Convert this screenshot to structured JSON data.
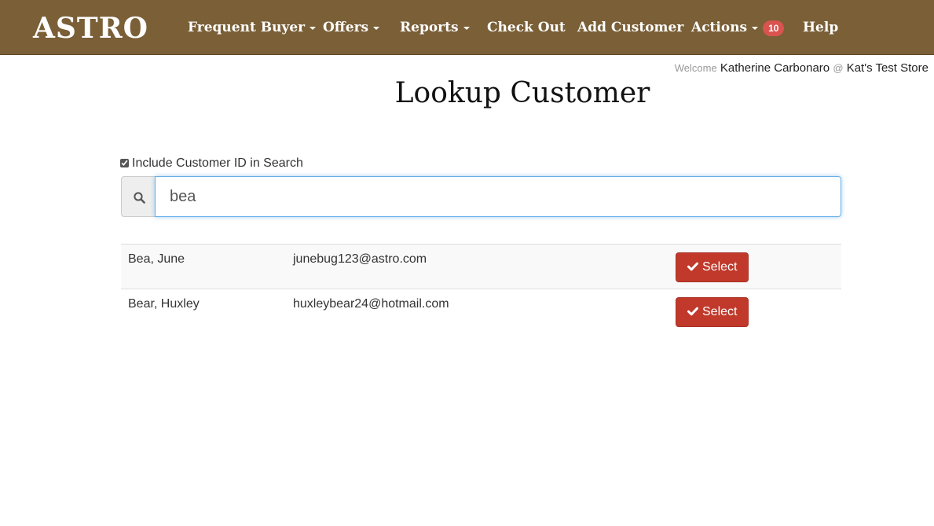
{
  "nav": {
    "brand": "ASTRO",
    "items": [
      {
        "label": "Frequent Buyer",
        "dropdown": true
      },
      {
        "label": "Offers",
        "dropdown": true
      },
      {
        "label": "Reports",
        "dropdown": true
      },
      {
        "label": "Check Out",
        "dropdown": false
      },
      {
        "label": "Add Customer",
        "dropdown": false
      },
      {
        "label": "Actions",
        "dropdown": true,
        "badge": "10"
      },
      {
        "label": "Help",
        "dropdown": false
      }
    ]
  },
  "welcome": {
    "prefix": "Welcome",
    "user": "Katherine Carbonaro",
    "at": "@",
    "store": "Kat's Test Store"
  },
  "page": {
    "title": "Lookup Customer"
  },
  "search": {
    "include_label": "Include Customer ID in Search",
    "include_checked": true,
    "value": "bea",
    "icon": "search-icon"
  },
  "results": [
    {
      "name": "Bea, June",
      "email": "junebug123@astro.com",
      "button": "Select"
    },
    {
      "name": "Bear, Huxley",
      "email": "huxleybear24@hotmail.com",
      "button": "Select"
    }
  ],
  "colors": {
    "navbar": "#7a5f37",
    "badge": "#d9534f",
    "select_button": "#c0392b",
    "focus_border": "#66afe9"
  }
}
